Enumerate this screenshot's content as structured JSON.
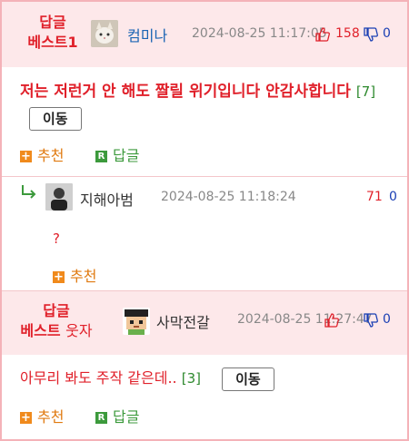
{
  "post1": {
    "badge_line1": "답글",
    "badge_line2": "베스트1",
    "nick": "컴미나",
    "time": "2024-08-25 11:17:05",
    "up": "158",
    "down": "0",
    "content": "저는 저런거 안 해도 짤릴 위기입니다 안감사합니다",
    "reply_count": "[7]",
    "move_label": "이동",
    "recommend_label": "추천",
    "reply_label": "답글"
  },
  "reply1": {
    "nick": "지해아범",
    "time": "2024-08-25 11:18:24",
    "up": "71",
    "down": "0",
    "content": "?",
    "recommend_label": "추천"
  },
  "post2": {
    "badge_line1": "답글",
    "badge_line2": "베스트",
    "badge_tag": "웃자",
    "nick": "사막전갈",
    "time": "2024-08-25 11:27:47",
    "up": "",
    "down": "0",
    "content": "아무리 봐도 주작 같은데..",
    "reply_count": "[3]",
    "move_label": "이동",
    "recommend_label": "추천",
    "reply_label": "답글"
  },
  "colors": {
    "accent_red": "#e0202a",
    "header_bg": "#fde8ea",
    "border": "#f4b2b8",
    "nick_blue": "#1a64b4",
    "plus_orange": "#f08a1c",
    "reply_green": "#3c9a3c"
  }
}
